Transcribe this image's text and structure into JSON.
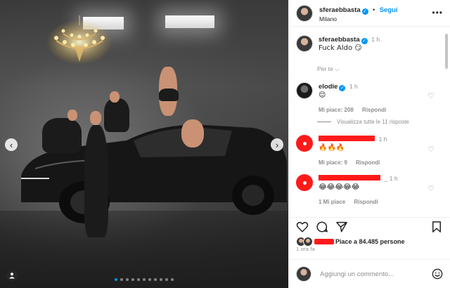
{
  "post": {
    "author": {
      "username": "sferaebbasta",
      "verified": true,
      "follow_label": "Segui",
      "separator": "•",
      "location": "Milano",
      "more_icon": "more-horizontal-icon"
    },
    "caption": {
      "username": "sferaebbasta",
      "time": "1 h",
      "text": "Fuck Aldo 😏"
    },
    "per_te_label": "Per te ⌵",
    "comments": [
      {
        "username": "elodie",
        "verified": true,
        "time": "1 h",
        "text": "😌",
        "likes": "Mi piace: 208",
        "reply_label": "Rispondi",
        "view_replies": "Visualizza tutte le 11 risposte"
      },
      {
        "username_suffix": "1 h",
        "text": "🔥🔥🔥",
        "likes": "Mi piace: 9",
        "reply_label": "Rispondi"
      },
      {
        "username_suffix": "_ 1 h",
        "text": "😂😂😂😂😂",
        "likes": "1 Mi piace",
        "reply_label": "Rispondi"
      }
    ],
    "likes_text": "Piace a 84.485 persone",
    "post_time": "1 ora fa",
    "add_comment_placeholder": "Aggiungi un commento...",
    "carousel": {
      "total": 11,
      "active_index": 0
    }
  },
  "colors": {
    "accent": "#0095f6",
    "redaction": "#ff1a1a",
    "muted": "#8e8e8e",
    "text": "#262626"
  }
}
